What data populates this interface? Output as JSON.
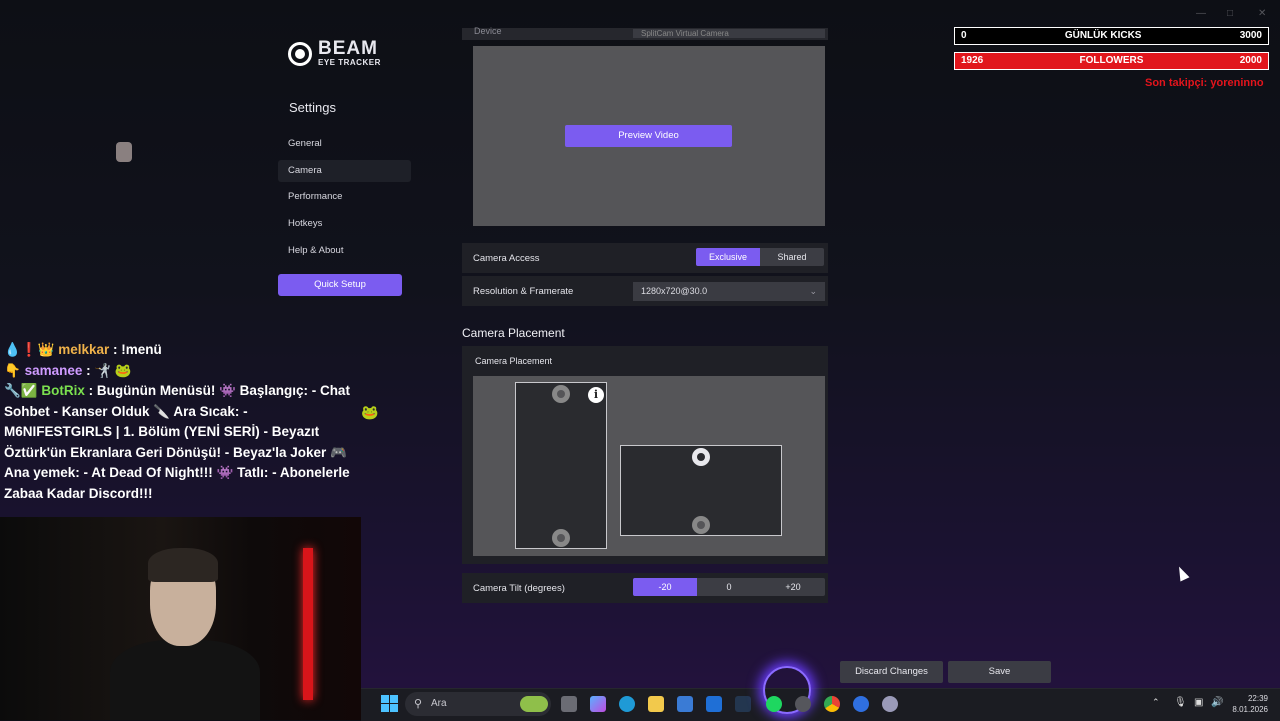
{
  "app": {
    "logo_title": "BEAM",
    "logo_subtitle": "EYE TRACKER",
    "settings_title": "Settings",
    "nav": [
      "General",
      "Camera",
      "Performance",
      "Hotkeys",
      "Help & About"
    ],
    "active_nav": "Camera",
    "quick_setup": "Quick Setup"
  },
  "camera": {
    "device_label": "Device",
    "device_value": "SplitCam Virtual Camera",
    "preview_button": "Preview Video",
    "access_label": "Camera Access",
    "access_options": [
      "Exclusive",
      "Shared"
    ],
    "access_selected": "Exclusive",
    "resolution_label": "Resolution & Framerate",
    "resolution_value": "1280x720@30.0",
    "placement_section": "Camera Placement",
    "placement_label": "Camera Placement",
    "tilt_label": "Camera Tilt (degrees)",
    "tilt_options": [
      "-20",
      "0",
      "+20"
    ],
    "tilt_selected": "-20",
    "discard": "Discard Changes",
    "save": "Save"
  },
  "overlay": {
    "kicks_left": "0",
    "kicks_title": "GÜNLÜK KICKS",
    "kicks_right": "3000",
    "followers_left": "1926",
    "followers_title": "FOLLOWERS",
    "followers_right": "2000",
    "last_follower": "Son takipçi: yoreninno"
  },
  "chat": [
    {
      "user": "melkkar",
      "text": ": !menü"
    },
    {
      "user": "samanee",
      "text": ":"
    },
    {
      "user": "BotRix",
      "text": ": Bugünün Menüsü! 👾 Başlangıç: - Chat Sohbet - Kanser Olduk 🔪 Ara Sıcak: - M6NIFESTGIRLS | 1. Bölüm (YENİ SERİ) - Beyazıt Öztürk'ün Ekranlara Geri Dönüşü! - Beyaz'la Joker 🎮 Ana yemek: - At Dead Of Night!!! 👾 Tatlı: - Abonelerle Zabaa Kadar Discord!!!"
    }
  ],
  "taskbar": {
    "search_placeholder": "Ara",
    "time": "22:39",
    "date": "8.01.2026"
  },
  "colors": {
    "accent": "#7b5cf0",
    "followers_bar": "#e1161c",
    "last_follower_text": "#e3141c"
  }
}
